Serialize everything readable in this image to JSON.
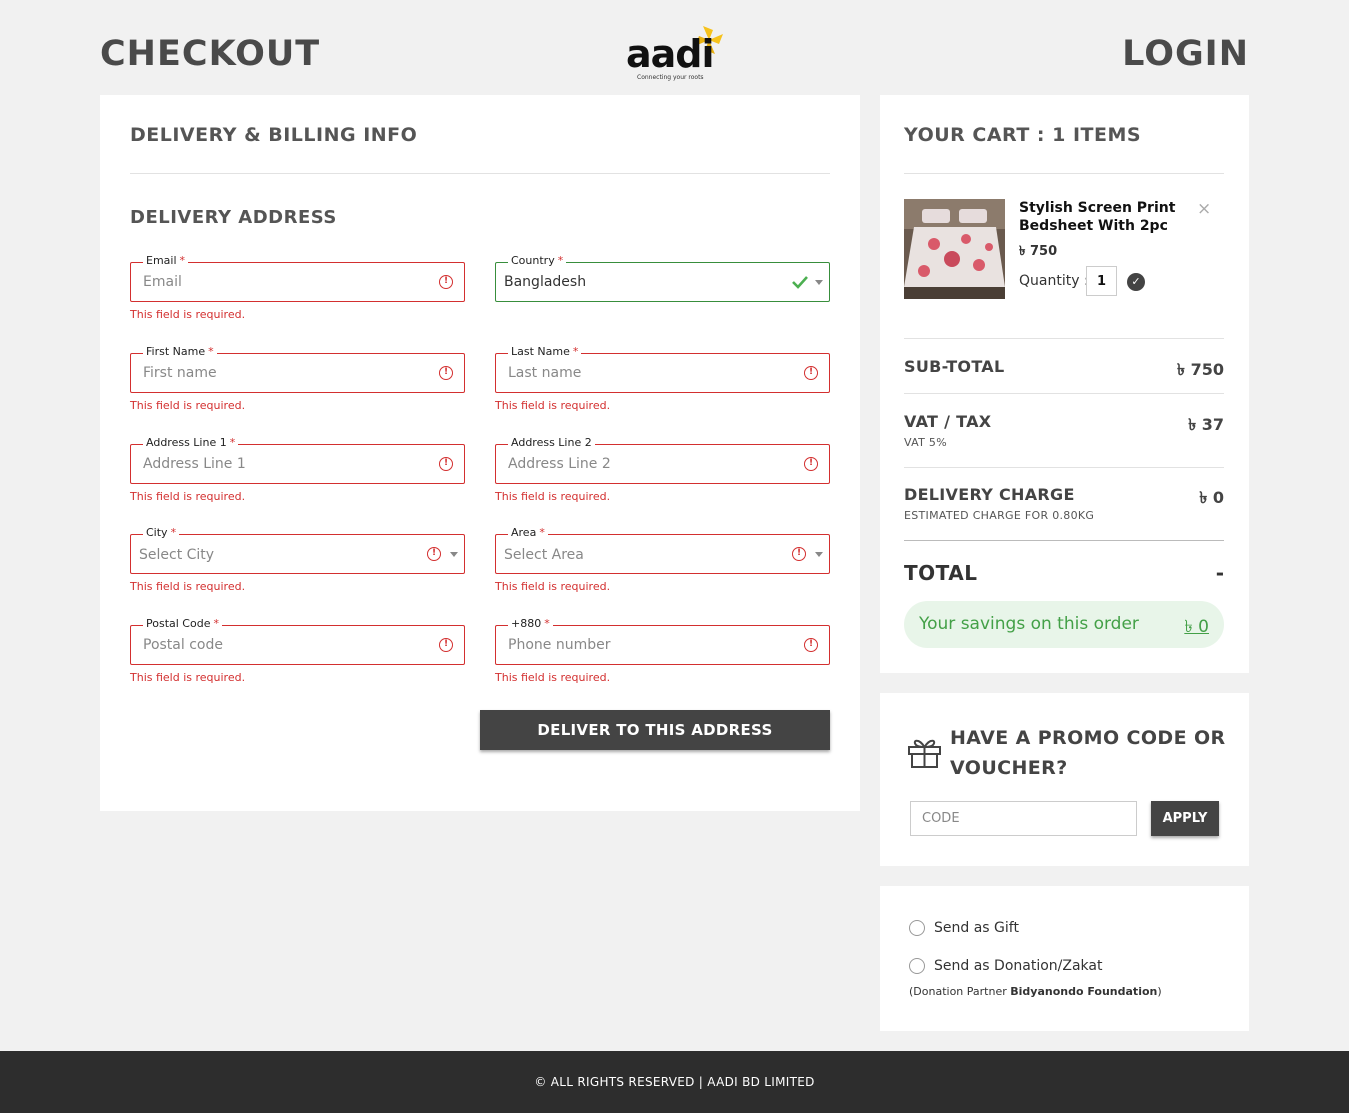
{
  "header": {
    "title": "CHECKOUT",
    "login": "LOGIN",
    "logo_word": "aadi",
    "logo_tagline": "Connecting your roots"
  },
  "billing": {
    "heading": "DELIVERY & BILLING INFO",
    "subheading": "DELIVERY ADDRESS",
    "required_mark": "*",
    "fields": {
      "email": {
        "label": "Email",
        "placeholder": "Email",
        "error": "This field is required."
      },
      "country": {
        "label": "Country",
        "value": "Bangladesh"
      },
      "first_name": {
        "label": "First Name",
        "placeholder": "First name",
        "error": "This field is required."
      },
      "last_name": {
        "label": "Last Name",
        "placeholder": "Last name",
        "error": "This field is required."
      },
      "address1": {
        "label": "Address Line 1",
        "placeholder": "Address Line 1",
        "error": "This field is required."
      },
      "address2": {
        "label": "Address Line 2",
        "placeholder": "Address Line 2",
        "error": "This field is required."
      },
      "city": {
        "label": "City",
        "placeholder": "Select City",
        "error": "This field is required."
      },
      "area": {
        "label": "Area",
        "placeholder": "Select Area",
        "error": "This field is required."
      },
      "postal": {
        "label": "Postal Code",
        "placeholder": "Postal code",
        "error": "This field is required."
      },
      "phone": {
        "label": "+880",
        "placeholder": "Phone number",
        "error": "This field is required."
      }
    },
    "submit": "DELIVER TO THIS ADDRESS"
  },
  "cart": {
    "heading": "YOUR CART : 1 ITEMS",
    "item": {
      "name": "Stylish Screen Print Bedsheet With 2pc",
      "price": "৳ 750",
      "quantity_label": "Quantity :",
      "quantity": "1"
    },
    "subtotal_label": "SUB-TOTAL",
    "subtotal_value": "৳ 750",
    "vat_label": "VAT / TAX",
    "vat_value": "৳ 37",
    "vat_note": "VAT 5%",
    "delivery_label": "DELIVERY CHARGE",
    "delivery_value": "৳ 0",
    "delivery_note": "ESTIMATED CHARGE FOR 0.80KG",
    "total_label": "TOTAL",
    "total_value": "-",
    "savings_label": "Your savings on this order",
    "savings_value": "৳ 0"
  },
  "promo": {
    "title": "HAVE A PROMO CODE OR VOUCHER?",
    "placeholder": "CODE",
    "apply": "APPLY"
  },
  "options": {
    "gift": "Send as Gift",
    "donation": "Send as Donation/Zakat",
    "partner_prefix": "(Donation Partner ",
    "partner_name": "Bidyanondo Foundation",
    "partner_suffix": ")"
  },
  "footer": {
    "text": "© ALL RIGHTS RESERVED | AADI BD LIMITED"
  },
  "colors": {
    "error": "#d32f2f",
    "valid": "#388e3c",
    "button": "#444444",
    "savings_bg": "#e8f5e9",
    "savings_text": "#43a047",
    "logo_accent": "#f6c21c"
  }
}
